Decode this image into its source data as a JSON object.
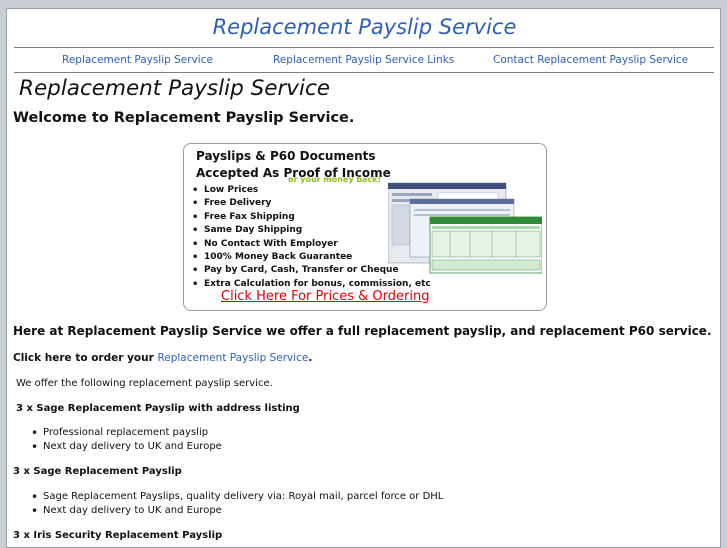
{
  "header": {
    "site_title": "Replacement Payslip Service"
  },
  "nav": {
    "links": [
      "Replacement Payslip Service",
      "Replacement Payslip Service Links",
      "Contact Replacement Payslip Service"
    ]
  },
  "main": {
    "page_heading": "Replacement Payslip Service",
    "welcome": "Welcome to Replacement Payslip Service.",
    "promo": {
      "title_line1": "Payslips & P60 Documents",
      "title_line2": "Accepted As Proof of Income",
      "money_back": "or your money back!",
      "features": [
        "Low Prices",
        "Free Delivery",
        "Free Fax Shipping",
        "Same Day Shipping",
        "No Contact With Employer",
        "100% Money Back Guarantee",
        "Pay by Card, Cash, Transfer or Cheque",
        "Extra Calculation for bonus, commission, etc"
      ],
      "cta": "Click Here For Prices & Ordering"
    },
    "intro": "Here at Replacement Payslip Service we offer a full replacement payslip, and replacement P60 service.",
    "order_prefix": "Click here to order your ",
    "order_link": "Replacement Payslip Service",
    "order_suffix": ".",
    "offer": "We offer the following replacement payslip service.",
    "sections": [
      {
        "heading": "3 x Sage Replacement Payslip with address listing",
        "items": [
          "Professional replacement payslip",
          "Next day delivery to UK and Europe"
        ]
      },
      {
        "heading": "3 x Sage Replacement Payslip",
        "items": [
          "Sage Replacement Payslips, quality delivery via: Royal mail, parcel force or DHL",
          "Next day delivery to UK and Europe"
        ]
      },
      {
        "heading": "3 x Iris Security Replacement Payslip",
        "items": []
      }
    ]
  },
  "colors": {
    "link": "#2f5fb3",
    "cta": "#e00000",
    "money_back": "#8fbf1a",
    "page_bg": "#c9cdd6"
  }
}
